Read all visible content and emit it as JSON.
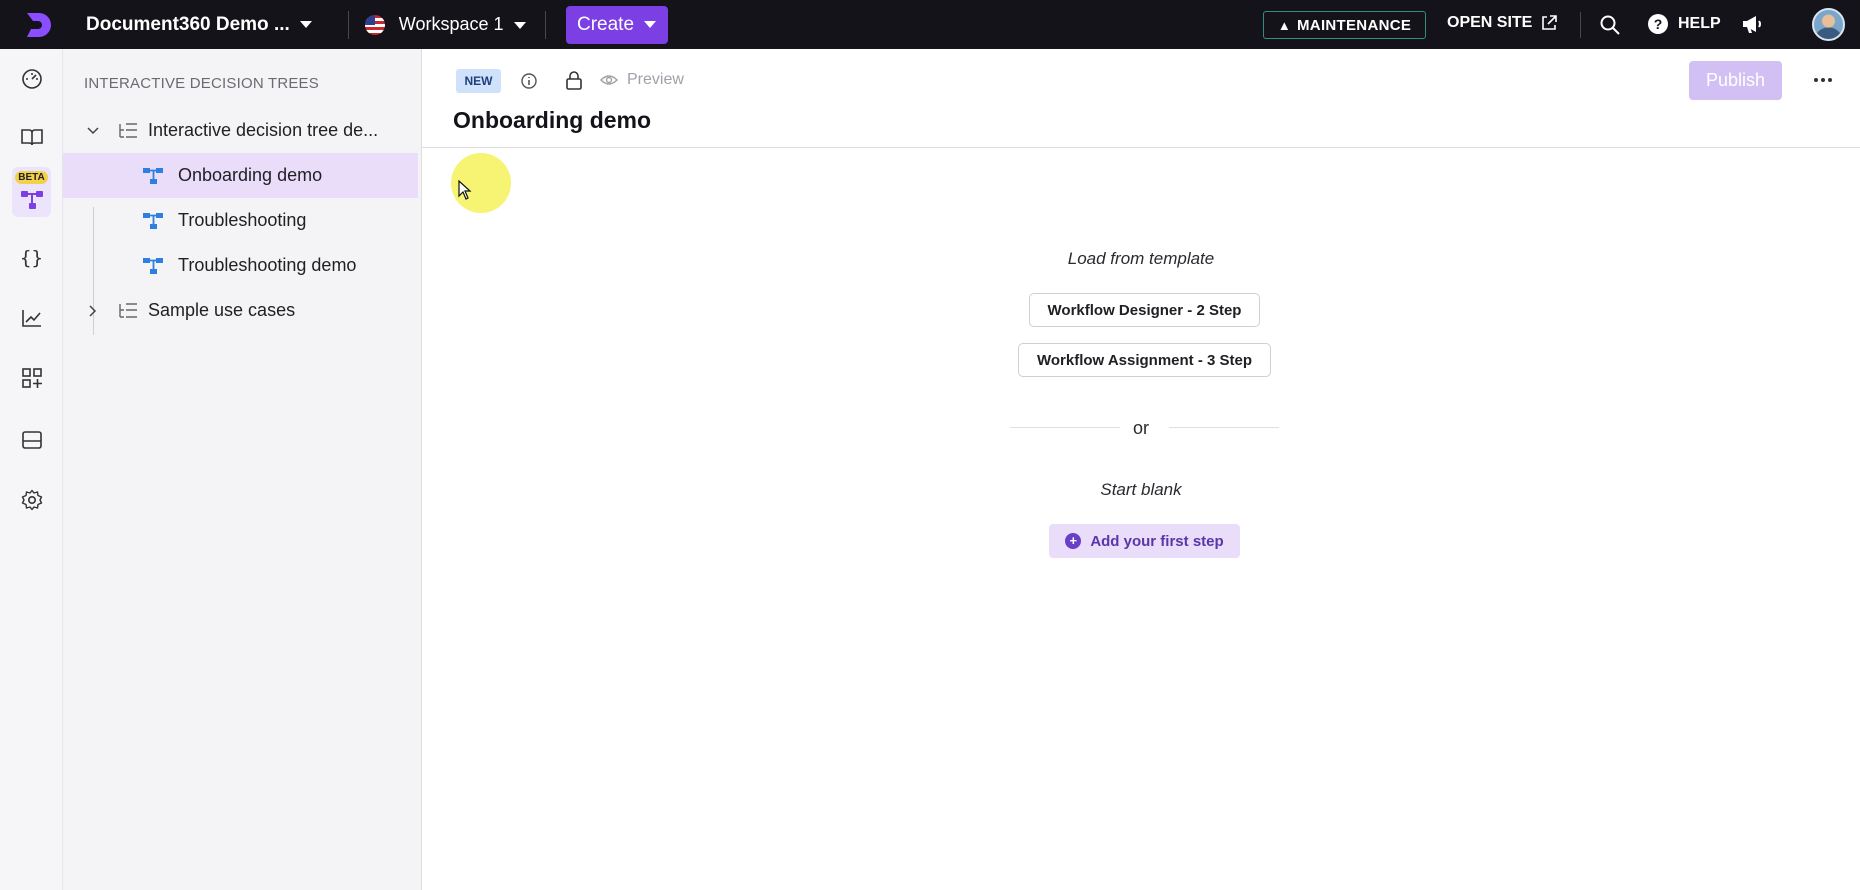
{
  "topbar": {
    "project_name": "Document360 Demo ...",
    "workspace": "Workspace 1",
    "create_label": "Create",
    "maintenance_label": "MAINTENANCE",
    "open_site_label": "OPEN SITE",
    "help_label": "HELP",
    "help_glyph": "?"
  },
  "rail": {
    "beta_label": "BETA",
    "icons": [
      "dashboard-icon",
      "documentation-icon",
      "decision-tree-icon",
      "api-icon",
      "analytics-icon",
      "integrations-icon",
      "widgets-icon",
      "settings-icon"
    ]
  },
  "tree": {
    "heading": "INTERACTIVE DECISION TREES",
    "items": [
      {
        "label": "Interactive decision tree de...",
        "type": "folder",
        "expanded": true
      },
      {
        "label": "Onboarding demo",
        "type": "tree",
        "active": true
      },
      {
        "label": "Troubleshooting",
        "type": "tree"
      },
      {
        "label": "Troubleshooting demo",
        "type": "tree"
      },
      {
        "label": "Sample use cases",
        "type": "folder",
        "expanded": false
      }
    ]
  },
  "editor": {
    "status_badge": "NEW",
    "preview_label": "Preview",
    "publish_label": "Publish",
    "title": "Onboarding demo",
    "load_template_label": "Load from template",
    "templates": [
      "Workflow Designer - 2 Step",
      "Workflow Assignment - 3 Step"
    ],
    "or_label": "or",
    "start_blank_label": "Start blank",
    "add_step_label": "Add your first step",
    "add_step_glyph": "+"
  },
  "colors": {
    "accent": "#7b3fe4",
    "topbar": "#15131a",
    "active_row": "#e9ddfa",
    "tree_icon": "#2d7fe0"
  }
}
